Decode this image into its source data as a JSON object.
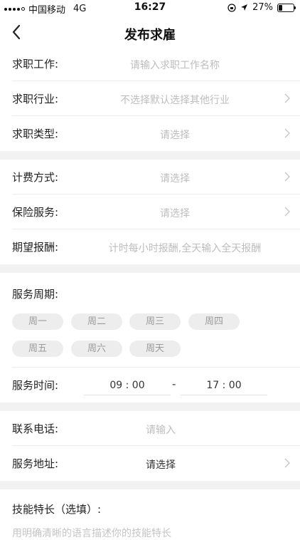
{
  "status_bar": {
    "carrier": "中国移动",
    "network": "4G",
    "time": "16:27",
    "battery": "27%",
    "battery_level": 0.27
  },
  "nav": {
    "back_icon": "chevron-left-icon",
    "title": "发布求雇"
  },
  "form": {
    "job_name": {
      "label": "求职工作:",
      "placeholder": "请输入求职工作名称"
    },
    "industry": {
      "label": "求职行业:",
      "placeholder": "不选择默认选择其他行业"
    },
    "job_type": {
      "label": "求职类型:",
      "placeholder": "请选择"
    },
    "billing": {
      "label": "计费方式:",
      "placeholder": "请选择"
    },
    "insurance": {
      "label": "保险服务:",
      "placeholder": "请选择"
    },
    "pay": {
      "label": "期望报酬:",
      "placeholder": "计时每小时报酬,全天输入全天报酬"
    },
    "service_period": {
      "label": "服务周期:",
      "days": [
        "周一",
        "周二",
        "周三",
        "周四",
        "周五",
        "周六",
        "周天"
      ]
    },
    "service_time": {
      "label": "服务时间:",
      "start": "09 : 00",
      "separator": "-",
      "end": "17 : 00"
    },
    "phone": {
      "label": "联系电话:",
      "placeholder": "请输入"
    },
    "address": {
      "label": "服务地址:",
      "value": "请选择"
    },
    "skills": {
      "label": "技能特长（选填）:",
      "placeholder": "用明确清晰的语言描述你的技能特长"
    }
  },
  "colors": {
    "separator": "#f2f2f2",
    "placeholder": "#bdbdbd",
    "chip_bg": "#ededed"
  }
}
